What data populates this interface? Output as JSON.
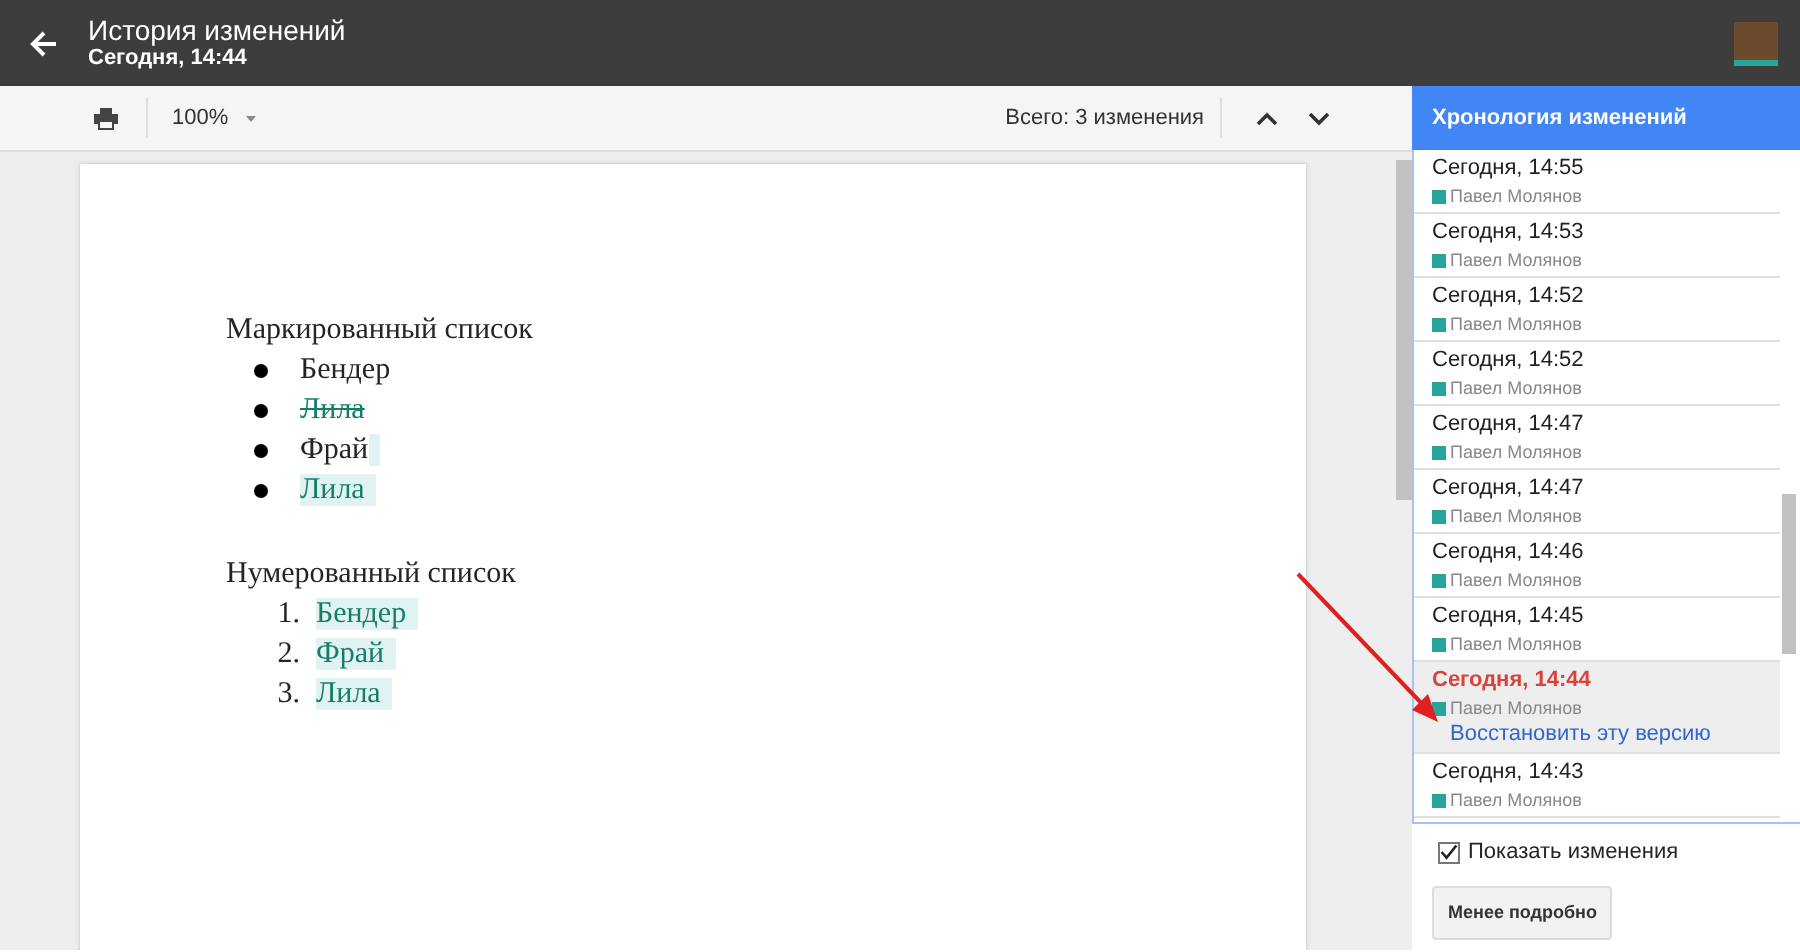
{
  "header": {
    "title": "История изменений",
    "subtitle": "Сегодня, 14:44"
  },
  "toolbar": {
    "zoom": "100%",
    "total": "Всего: 3 изменения"
  },
  "document": {
    "sections": [
      {
        "heading": "Маркированный список",
        "kind": "bullet",
        "items": [
          {
            "text": "Бендер",
            "kind": "plain"
          },
          {
            "text": "Лила",
            "kind": "deleted"
          },
          {
            "text": "Фрай",
            "kind": "appended"
          },
          {
            "text": "Лила",
            "kind": "added"
          }
        ]
      },
      {
        "heading": "Нумерованный список",
        "kind": "numbered",
        "items": [
          {
            "number": "1.",
            "text": "Бендер",
            "kind": "added"
          },
          {
            "number": "2.",
            "text": "Фрай",
            "kind": "added"
          },
          {
            "number": "3.",
            "text": "Лила",
            "kind": "added"
          }
        ]
      }
    ]
  },
  "sidebar": {
    "title": "Хронология изменений",
    "revisions": [
      {
        "time": "Сегодня, 14:55",
        "author": "Павел Молянов",
        "color": "#26a69a",
        "selected": false
      },
      {
        "time": "Сегодня, 14:53",
        "author": "Павел Молянов",
        "color": "#26a69a",
        "selected": false
      },
      {
        "time": "Сегодня, 14:52",
        "author": "Павел Молянов",
        "color": "#26a69a",
        "selected": false
      },
      {
        "time": "Сегодня, 14:52",
        "author": "Павел Молянов",
        "color": "#26a69a",
        "selected": false
      },
      {
        "time": "Сегодня, 14:47",
        "author": "Павел Молянов",
        "color": "#26a69a",
        "selected": false
      },
      {
        "time": "Сегодня, 14:47",
        "author": "Павел Молянов",
        "color": "#26a69a",
        "selected": false
      },
      {
        "time": "Сегодня, 14:46",
        "author": "Павел Молянов",
        "color": "#26a69a",
        "selected": false
      },
      {
        "time": "Сегодня, 14:45",
        "author": "Павел Молянов",
        "color": "#26a69a",
        "selected": false
      },
      {
        "time": "Сегодня, 14:44",
        "author": "Павел Молянов",
        "color": "#26a69a",
        "selected": true,
        "restore_link": "Восстановить эту версию"
      },
      {
        "time": "Сегодня, 14:43",
        "author": "Павел Молянов",
        "color": "#26a69a",
        "selected": false
      }
    ],
    "show_changes": {
      "label": "Показать изменения",
      "checked": true
    },
    "button": "Менее подробно"
  }
}
